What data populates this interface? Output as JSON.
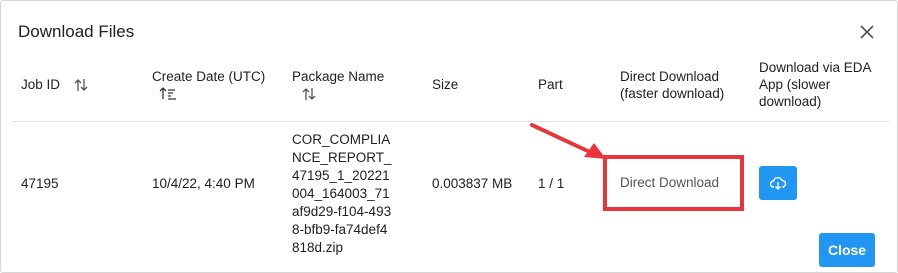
{
  "dialog": {
    "title": "Download Files",
    "close_icon": "close-icon"
  },
  "table": {
    "headers": {
      "job_id": "Job ID",
      "create_date_line1": "Create Date (UTC)",
      "package_name": "Package Name",
      "size": "Size",
      "part": "Part",
      "direct_line1": "Direct Download",
      "direct_line2": "(faster download)",
      "eda_line1": "Download via EDA",
      "eda_line2": "App (slower",
      "eda_line3": "download)"
    },
    "row": {
      "job_id": "47195",
      "create_date": "10/4/22, 4:40 PM",
      "package_name": "COR_COMPLIANCE_REPORT_47195_1_20221004_164003_71af9d29-f104-4938-bfb9-fa74def4818d.zip",
      "size": "0.003837 MB",
      "part": "1 / 1",
      "direct_download_label": "Direct Download",
      "eda_icon": "cloud-download-icon"
    }
  },
  "footer": {
    "close_label": "Close"
  },
  "colors": {
    "accent": "#2196f3",
    "annotation": "#e8353b"
  }
}
